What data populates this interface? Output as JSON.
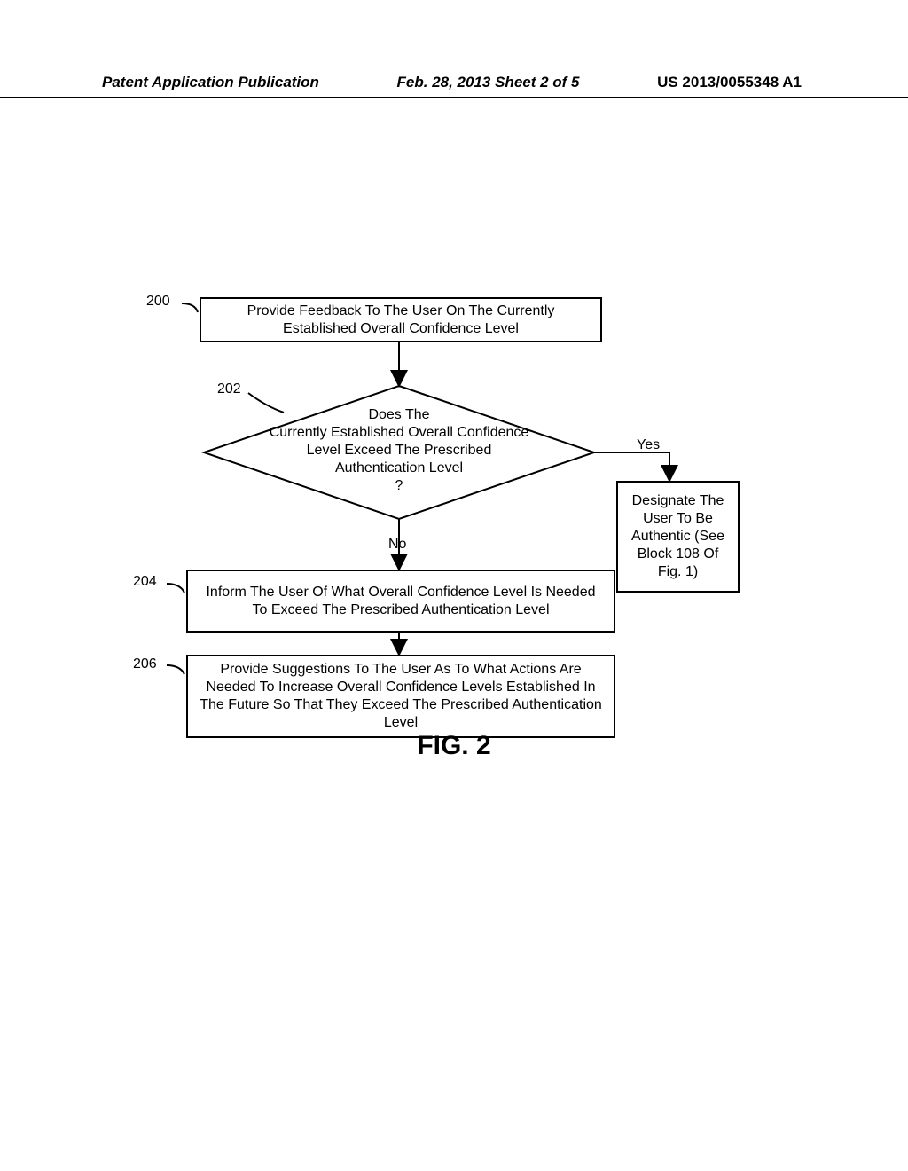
{
  "header": {
    "left": "Patent Application Publication",
    "center": "Feb. 28, 2013  Sheet 2 of 5",
    "right": "US 2013/0055348 A1"
  },
  "figure_label": "FIG. 2",
  "refs": {
    "r200": "200",
    "r202": "202",
    "r204": "204",
    "r206": "206"
  },
  "blocks": {
    "b200": "Provide Feedback To The User On The Currently Established Overall Confidence Level",
    "b202": "Does The\nCurrently Established Overall Confidence\nLevel Exceed The Prescribed\nAuthentication Level\n?",
    "b204": "Inform The User Of What Overall Confidence Level Is Needed To Exceed The Prescribed Authentication Level",
    "b206": "Provide Suggestions To The User As To What Actions Are Needed To Increase Overall Confidence Levels Established In The Future So That They Exceed The Prescribed Authentication Level",
    "byes": "Designate The User To Be Authentic (See Block 108 Of Fig. 1)"
  },
  "edges": {
    "yes": "Yes",
    "no": "No"
  }
}
